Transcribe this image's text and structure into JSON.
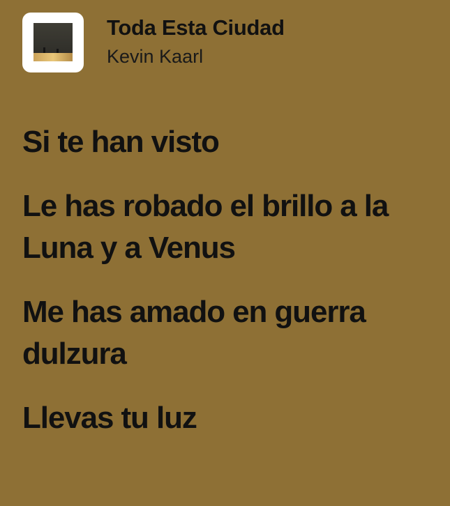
{
  "theme": {
    "background": "#8E7035",
    "text": "#111111"
  },
  "track": {
    "cover_icon": "album-cover-image",
    "title": "Toda Esta Ciudad",
    "artist": "Kevin Kaarl"
  },
  "lyrics": [
    "Si te han visto",
    "Le has robado el brillo a la Luna y a Venus",
    "Me has amado en guerra dulzura",
    "Llevas tu luz"
  ]
}
